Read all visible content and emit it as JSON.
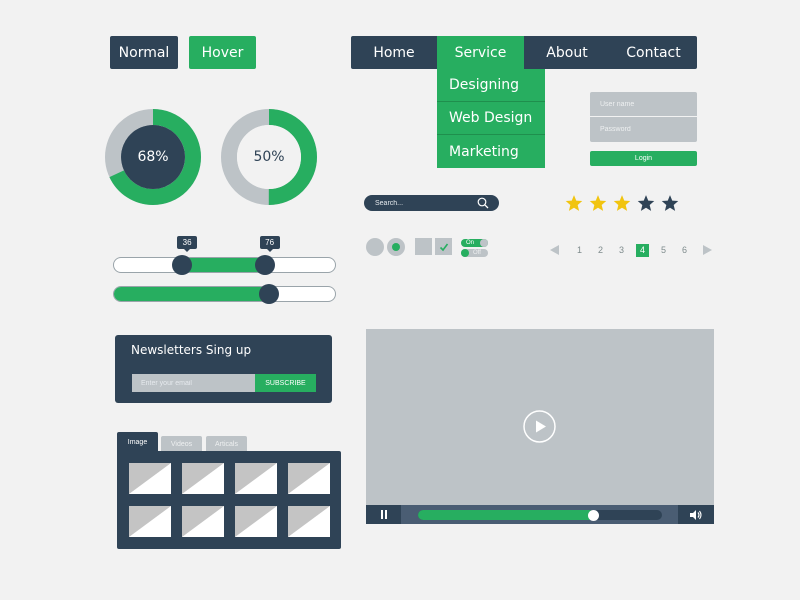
{
  "buttons": {
    "normal_label": "Normal",
    "hover_label": "Hover"
  },
  "nav": {
    "items": [
      "Home",
      "Service",
      "About",
      "Contact"
    ],
    "active_index": 1,
    "dropdown": [
      "Designing",
      "Web Design",
      "Marketing"
    ]
  },
  "login": {
    "username_placeholder": "User name",
    "password_placeholder": "Password",
    "button_label": "Login"
  },
  "donuts": [
    {
      "label": "68%",
      "value": 0.68,
      "center": "filled"
    },
    {
      "label": "50%",
      "value": 0.5,
      "center": "hollow"
    }
  ],
  "search": {
    "placeholder": "Search...",
    "icon": "search-icon"
  },
  "rating": {
    "value": 3,
    "max": 5
  },
  "controls": {
    "radio_checked": [
      false,
      true
    ],
    "checkbox_checked": [
      false,
      true
    ],
    "toggle_on_label": "On",
    "toggle_off_label": "Off"
  },
  "pagination": {
    "pages": [
      "1",
      "2",
      "3",
      "4",
      "5",
      "6"
    ],
    "current": "4"
  },
  "sliders": {
    "range": {
      "low": 36,
      "high": 76,
      "low_label": "36",
      "high_label": "76"
    },
    "single": {
      "value": 0.7
    }
  },
  "newsletter": {
    "title": "Newsletters Sing up",
    "email_placeholder": "Enter your email",
    "button_label": "SUBSCRIBE"
  },
  "gallery": {
    "tabs": [
      "Image",
      "Videos",
      "Articals"
    ],
    "active_tab": 0,
    "thumbnail_count": 8
  },
  "video": {
    "progress": 0.72,
    "play_icon": "play-icon",
    "pause_icon": "pause-icon",
    "volume_icon": "volume-icon"
  },
  "colors": {
    "navy": "#2f4356",
    "green": "#27ae60",
    "gray": "#bdc3c7",
    "star_gold": "#f1c40f",
    "background": "#f2f2f2"
  }
}
